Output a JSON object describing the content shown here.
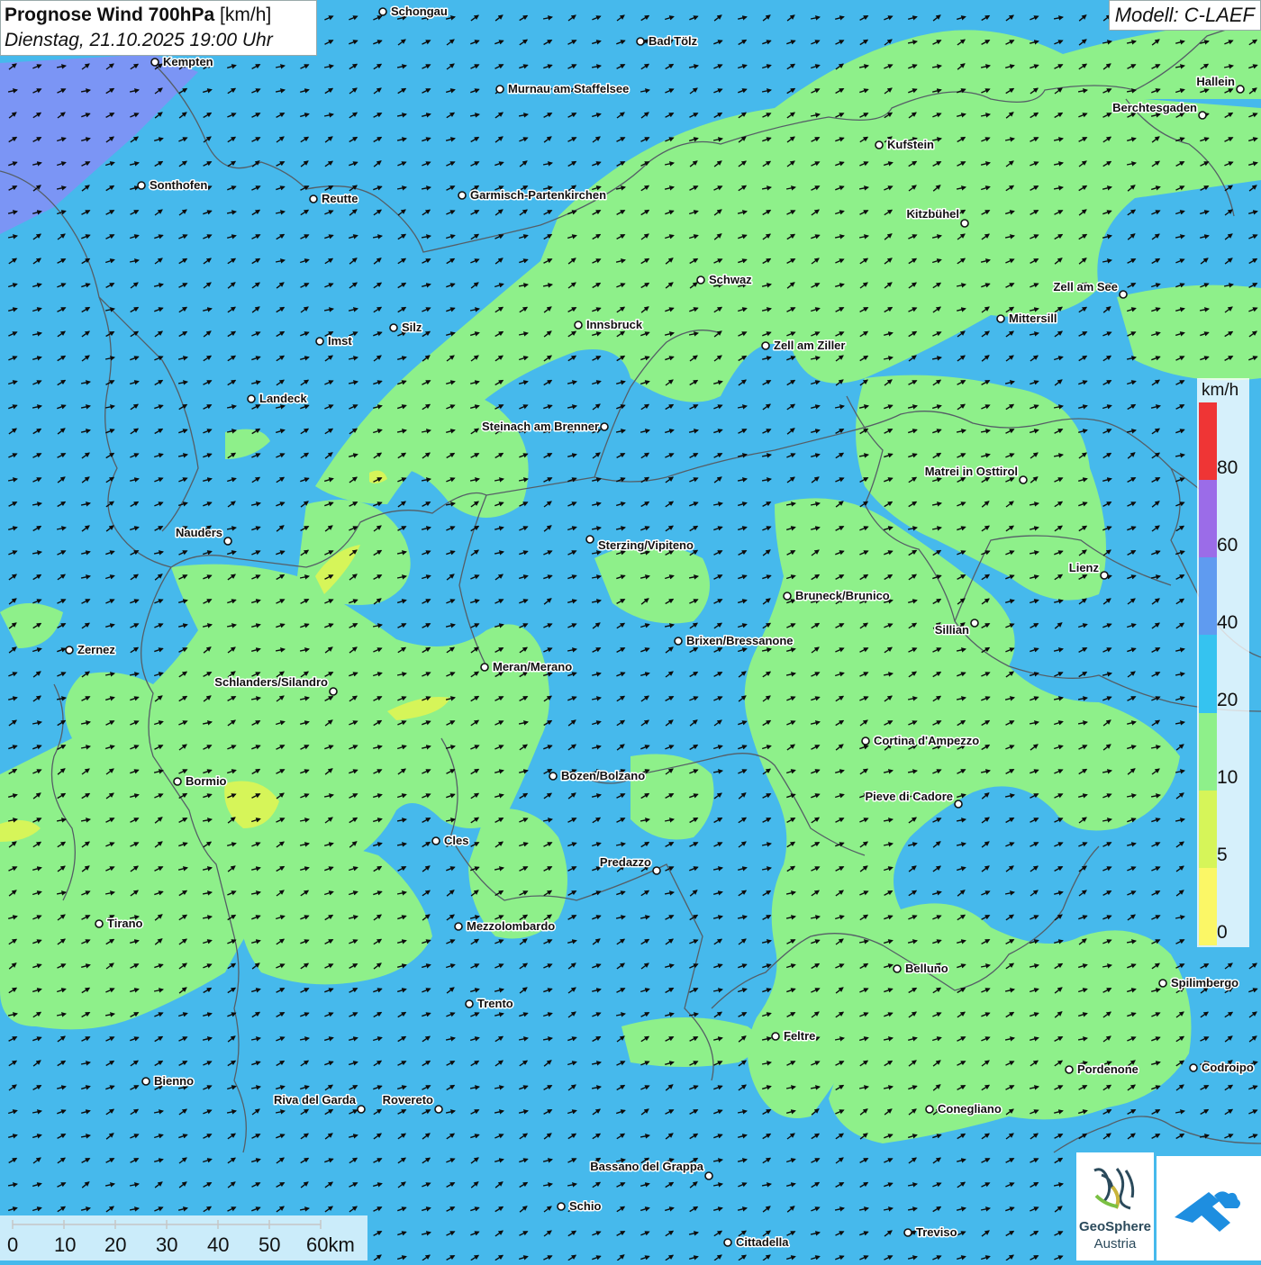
{
  "header": {
    "title_bold": "Prognose Wind 700hPa",
    "title_unit": "[km/h]",
    "datetime": "Dienstag, 21.10.2025 19:00 Uhr",
    "model": "Modell: C-LAEF"
  },
  "legend": {
    "unit": "km/h",
    "labels": [
      "80",
      "60",
      "40",
      "20",
      "10",
      "5",
      "0"
    ],
    "colors": [
      "#ef3535",
      "#9b6ce8",
      "#5f9bf0",
      "#35c3f0",
      "#8ef08a",
      "#d6f559",
      "#fbf766"
    ]
  },
  "scalebar": {
    "labels": [
      "0",
      "10",
      "20",
      "30",
      "40",
      "50",
      "60km"
    ]
  },
  "logos": {
    "org_name": "GeoSphere",
    "org_sub": "Austria"
  },
  "map": {
    "colors": {
      "base": "#46b9ec",
      "low": "#8ef08a",
      "weak": "#d6f559",
      "strong": "#7b95f5",
      "border": "#555e66",
      "arrow": "#0d0d0d"
    },
    "wind_direction": "south-west to north-east",
    "cities": [
      {
        "name": "Schongau"
      },
      {
        "name": "Bad Tölz"
      },
      {
        "name": "Kempten"
      },
      {
        "name": "Murnau am Staffelsee"
      },
      {
        "name": "Hallein"
      },
      {
        "name": "Berchtesgaden"
      },
      {
        "name": "Kufstein"
      },
      {
        "name": "Sonthofen"
      },
      {
        "name": "Reutte"
      },
      {
        "name": "Garmisch-Partenkirchen"
      },
      {
        "name": "Kitzbühel"
      },
      {
        "name": "Schwaz"
      },
      {
        "name": "Zell am See"
      },
      {
        "name": "Innsbruck"
      },
      {
        "name": "Mittersill"
      },
      {
        "name": "Imst"
      },
      {
        "name": "Silz"
      },
      {
        "name": "Zell am Ziller"
      },
      {
        "name": "Landeck"
      },
      {
        "name": "Steinach am Brenner"
      },
      {
        "name": "Matrei in Osttirol"
      },
      {
        "name": "Nauders"
      },
      {
        "name": "Sterzing/Vipiteno"
      },
      {
        "name": "Lienz"
      },
      {
        "name": "Bruneck/Brunico"
      },
      {
        "name": "Sillian"
      },
      {
        "name": "Zernez"
      },
      {
        "name": "Brixen/Bressanone"
      },
      {
        "name": "Meran/Merano"
      },
      {
        "name": "Schlanders/Silandro"
      },
      {
        "name": "Cortina d'Ampezzo"
      },
      {
        "name": "Bozen/Bolzano"
      },
      {
        "name": "Bormio"
      },
      {
        "name": "Pieve di Cadore"
      },
      {
        "name": "Cles"
      },
      {
        "name": "Predazzo"
      },
      {
        "name": "Tirano"
      },
      {
        "name": "Mezzolombardo"
      },
      {
        "name": "Belluno"
      },
      {
        "name": "Spilimbergo"
      },
      {
        "name": "Trento"
      },
      {
        "name": "Feltre"
      },
      {
        "name": "Pordenone"
      },
      {
        "name": "Codroipo"
      },
      {
        "name": "Bienno"
      },
      {
        "name": "Riva del Garda"
      },
      {
        "name": "Rovereto"
      },
      {
        "name": "Conegliano"
      },
      {
        "name": "Bassano del Grappa"
      },
      {
        "name": "Schio"
      },
      {
        "name": "Treviso"
      },
      {
        "name": "Cittadella"
      }
    ]
  }
}
